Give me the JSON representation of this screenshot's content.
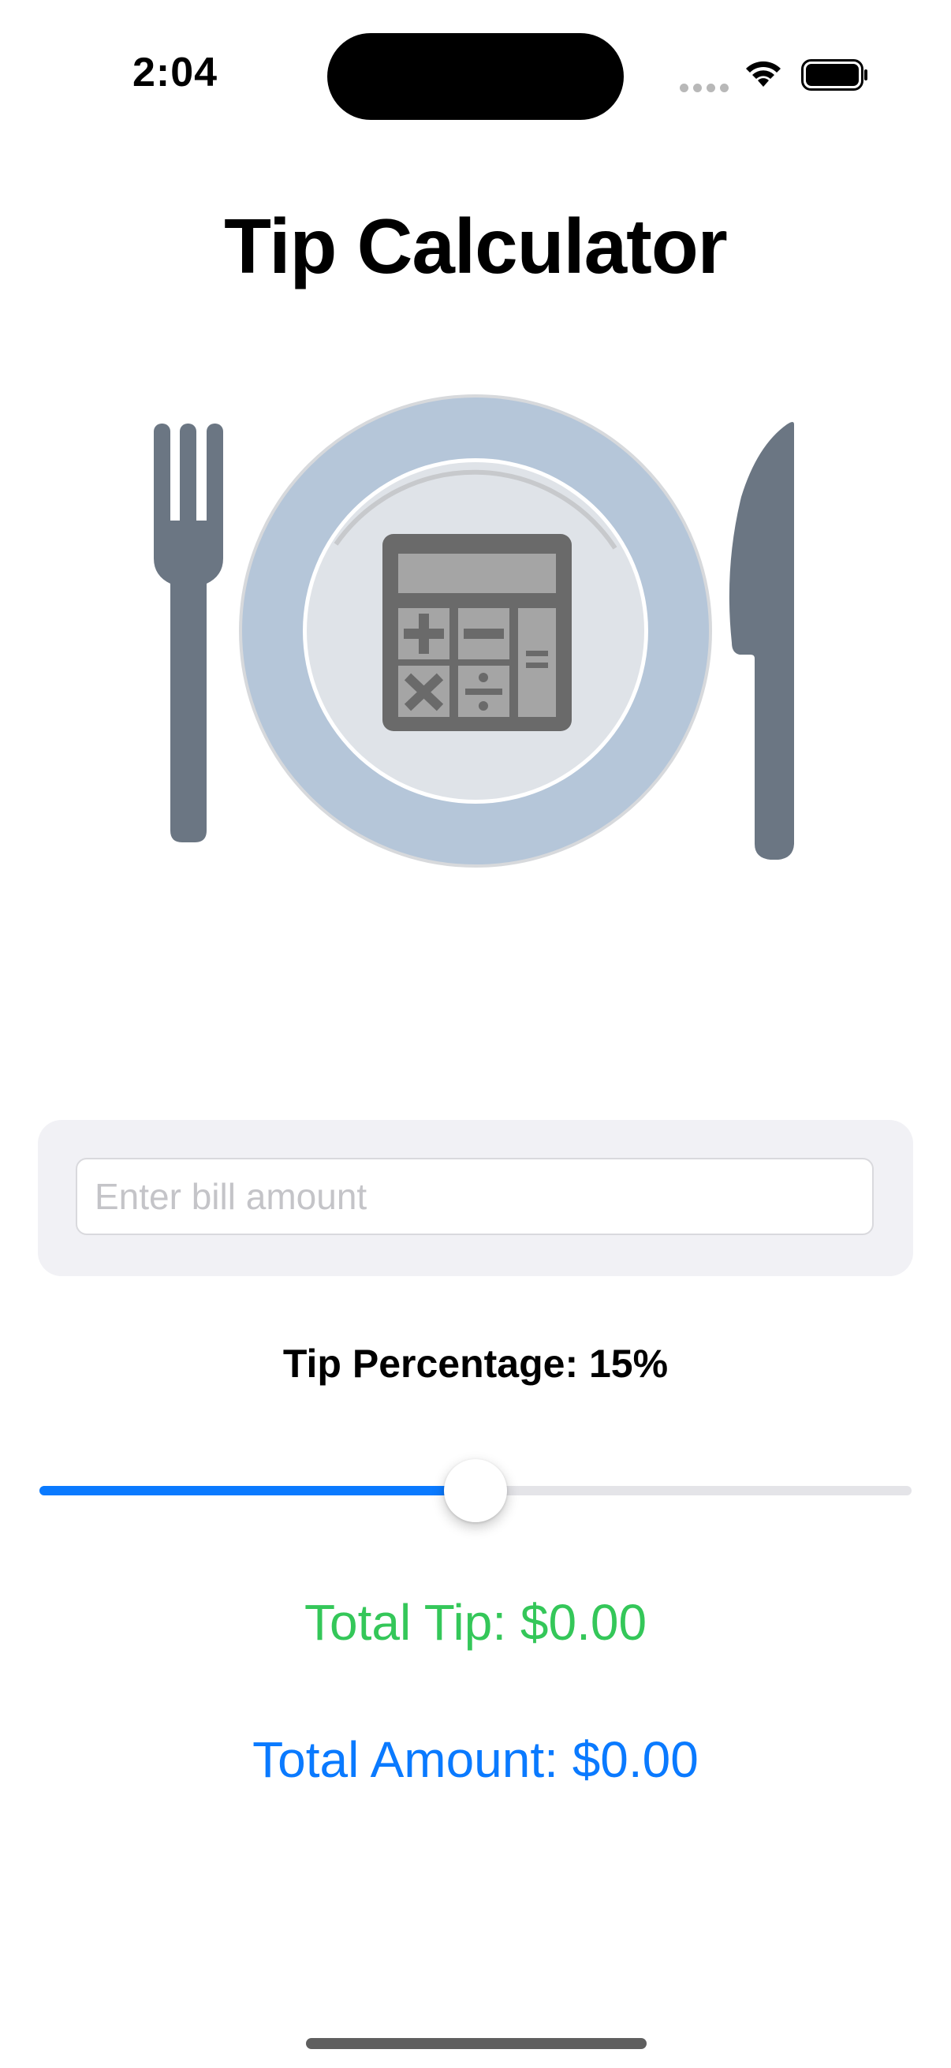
{
  "status_bar": {
    "time": "2:04"
  },
  "header": {
    "title": "Tip Calculator"
  },
  "hero": {
    "icons": [
      "fork-icon",
      "plate-icon",
      "calculator-icon",
      "knife-icon"
    ]
  },
  "bill": {
    "value": "",
    "placeholder": "Enter bill amount"
  },
  "tip": {
    "label": "Tip Percentage: 15%",
    "percent": 15,
    "slider_fraction": 0.5
  },
  "results": {
    "total_tip": "Total Tip: $0.00",
    "total_amount": "Total Amount: $0.00"
  },
  "colors": {
    "accent": "#0a7aff",
    "tip_green": "#34c759",
    "plate_rim": "#b5c6d9",
    "utensil": "#6b7683"
  }
}
